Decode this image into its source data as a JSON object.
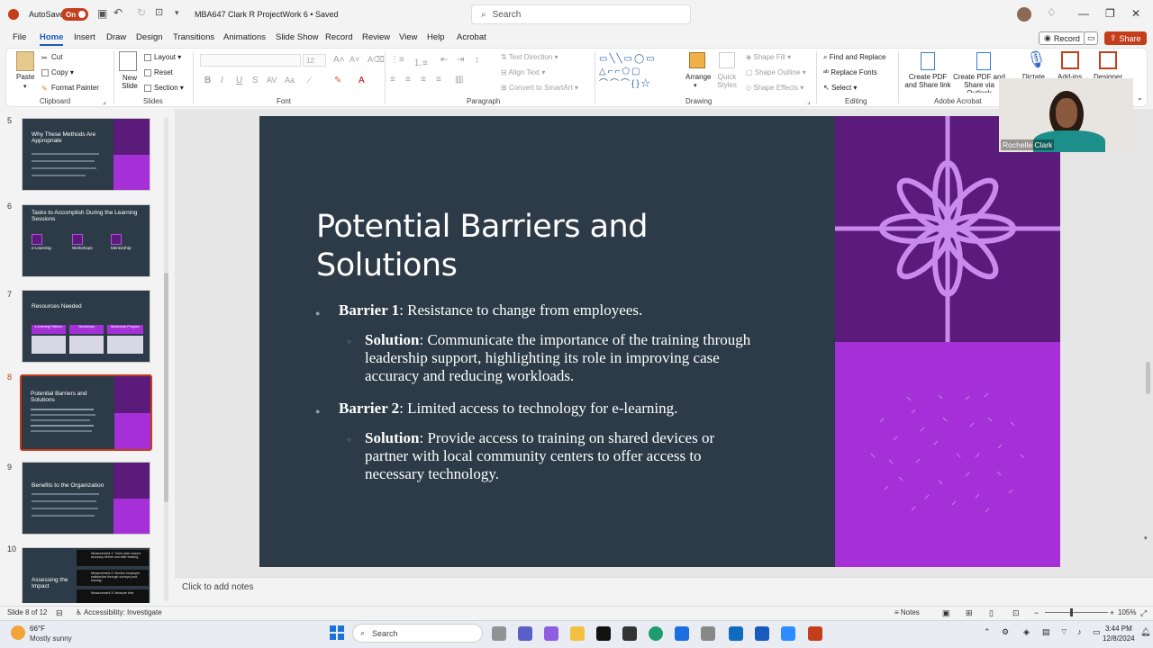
{
  "titlebar": {
    "autosave_label": "AutoSave",
    "toggle_label": "On",
    "doc_title": "MBA647 Clark R ProjectWork 6 • Saved",
    "search_placeholder": "Search"
  },
  "menu": {
    "tabs": [
      "File",
      "Home",
      "Insert",
      "Draw",
      "Design",
      "Transitions",
      "Animations",
      "Slide Show",
      "Record",
      "Review",
      "View",
      "Help",
      "Acrobat"
    ],
    "record_label": "Record",
    "share_label": "Share"
  },
  "ribbon": {
    "clipboard": {
      "paste": "Paste",
      "cut": "Cut",
      "copy": "Copy",
      "format_painter": "Format Painter",
      "group": "Clipboard"
    },
    "slides": {
      "new_slide": "New Slide",
      "layout": "Layout",
      "reset": "Reset",
      "section": "Section",
      "group": "Slides"
    },
    "font": {
      "font_size": "12",
      "group": "Font"
    },
    "paragraph": {
      "text_direction": "Text Direction",
      "align_text": "Align Text",
      "convert_smartart": "Convert to SmartArt",
      "group": "Paragraph"
    },
    "drawing": {
      "arrange": "Arrange",
      "quick_styles": "Quick Styles",
      "shape_fill": "Shape Fill",
      "shape_outline": "Shape Outline",
      "shape_effects": "Shape Effects",
      "group": "Drawing"
    },
    "editing": {
      "find_replace": "Find and Replace",
      "replace_fonts": "Replace Fonts",
      "select": "Select",
      "group": "Editing"
    },
    "acrobat": {
      "create_pdf_share": "Create PDF and Share link",
      "create_pdf_outlook": "Create PDF and Share via Outlook",
      "group": "Adobe Acrobat"
    },
    "extra": {
      "dictate": "Dictate",
      "addins": "Add-ins",
      "designer": "Designer"
    }
  },
  "thumbnails": [
    {
      "num": "5",
      "title": "Why These Methods Are Appropriate"
    },
    {
      "num": "6",
      "title": "Tasks to Accomplish During the Learning Sessions",
      "cols": [
        "e-Learning:",
        "Workshops:",
        "Mentorship:"
      ]
    },
    {
      "num": "7",
      "title": "Resources Needed",
      "cols": [
        "e-Learning Platform",
        "Workshops",
        "Mentorship Program"
      ]
    },
    {
      "num": "8",
      "title": "Potential Barriers and Solutions"
    },
    {
      "num": "9",
      "title": "Benefits to the Organization"
    },
    {
      "num": "10",
      "title": "Assessing the Impact",
      "items": [
        "Measurement 1: Track case closure accuracy before and after training.",
        "Measurement 2: Monitor employee satisfaction through surveys post-training.",
        "Measurement 3: Measure time"
      ]
    }
  ],
  "slide": {
    "title": "Potential Barriers and Solutions",
    "barrier1_label": "Barrier 1",
    "barrier1_text": ": Resistance to change from employees.",
    "solution1_label": "Solution",
    "solution1_text": ": Communicate the importance of the training through leadership support, highlighting its role in improving case accuracy and reducing workloads.",
    "barrier2_label": "Barrier 2",
    "barrier2_text": ": Limited access to technology for e-learning.",
    "solution2_label": "Solution",
    "solution2_text": ": Provide access to training on shared devices or partner with local community centers to offer access to necessary technology."
  },
  "webcam": {
    "name": "Rochelle Clark"
  },
  "notes_placeholder": "Click to add notes",
  "status": {
    "slide_count": "Slide 8 of 12",
    "accessibility": "Accessibility: Investigate",
    "notes": "Notes",
    "zoom": "105%"
  },
  "taskbar": {
    "temp": "66°F",
    "weather": "Mostly sunny",
    "search": "Search",
    "time": "3:44 PM",
    "date": "12/8/2024"
  },
  "colors": {
    "accent": "#185abd",
    "slide_bg": "#2c3b47",
    "purple_dark": "#5a1b7a",
    "purple_light": "#a630d8",
    "ppt_red": "#c43e1c"
  }
}
